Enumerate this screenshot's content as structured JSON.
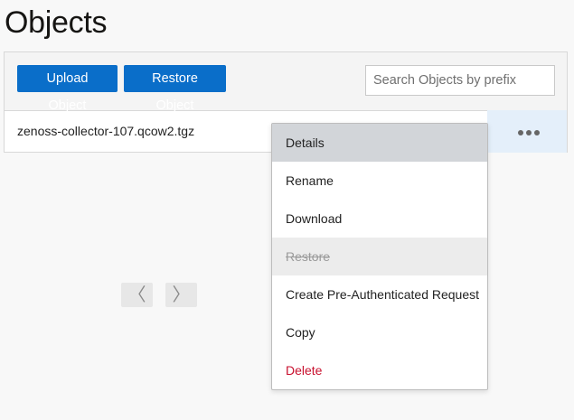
{
  "page": {
    "title": "Objects"
  },
  "toolbar": {
    "upload_label": "Upload Object",
    "restore_label": "Restore Object",
    "search_placeholder": "Search Objects by prefix"
  },
  "objects": [
    {
      "name": "zenoss-collector-107.qcow2.tgz"
    }
  ],
  "pager": {
    "prev": "〈",
    "next": "〉"
  },
  "context_menu": {
    "items": [
      {
        "label": "Details",
        "state": "highlighted"
      },
      {
        "label": "Rename",
        "state": "normal"
      },
      {
        "label": "Download",
        "state": "normal"
      },
      {
        "label": "Restore",
        "state": "disabled"
      },
      {
        "label": "Create Pre-Authenticated Request",
        "state": "normal"
      },
      {
        "label": "Copy",
        "state": "normal"
      },
      {
        "label": "Delete",
        "state": "danger"
      }
    ]
  },
  "colors": {
    "accent": "#0a6ec9",
    "danger": "#c8102e",
    "row_action_bg": "#e4effa"
  }
}
